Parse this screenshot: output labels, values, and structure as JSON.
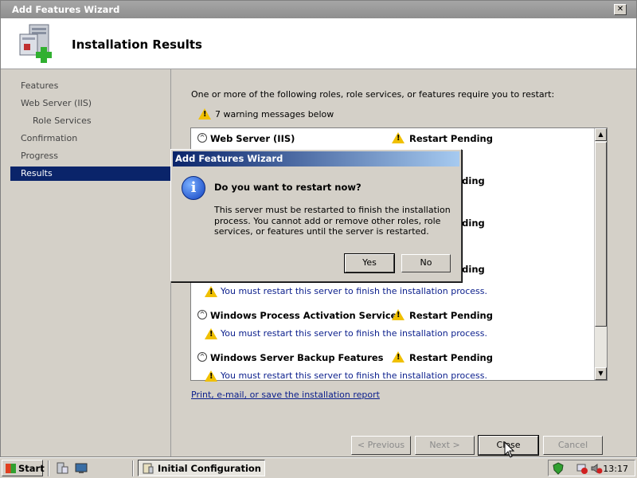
{
  "window": {
    "title": "Add Features Wizard",
    "close_glyph": "✕"
  },
  "header": {
    "page_title": "Installation Results"
  },
  "sidebar": {
    "items": [
      {
        "label": "Features"
      },
      {
        "label": "Web Server (IIS)"
      },
      {
        "label": "Role Services"
      },
      {
        "label": "Confirmation"
      },
      {
        "label": "Progress"
      },
      {
        "label": "Results"
      }
    ]
  },
  "main": {
    "restart_message": "One or more of the following roles, role services, or features require you to restart:",
    "warning_summary": "7 warning messages below",
    "groups": [
      {
        "name": "Web Server (IIS)",
        "status": "Restart Pending",
        "message": ""
      },
      {
        "name": "",
        "status": "",
        "message": "You must restart this server to finish the installation process."
      },
      {
        "name": "Windows Process Activation Service",
        "status": "Restart Pending",
        "message": "You must restart this server to finish the installation process."
      },
      {
        "name": "Windows Server Backup Features",
        "status": "Restart Pending",
        "message": "You must restart this server to finish the installation process."
      }
    ],
    "partial_status": "nding",
    "report_link": "Print, e-mail, or save the installation report",
    "buttons": {
      "previous": "< Previous",
      "next": "Next >",
      "close": "Close",
      "cancel": "Cancel"
    }
  },
  "dialog": {
    "title": "Add Features Wizard",
    "question": "Do you want to restart now?",
    "body": "This server must be restarted to finish the installation process. You cannot add or remove other roles, role services, or features until the server is restarted.",
    "yes": "Yes",
    "no": "No",
    "info_glyph": "i"
  },
  "taskbar": {
    "start": "Start",
    "task": "Initial Configuration T...",
    "clock": "13:17"
  },
  "colors": {
    "selection": "#0a246a",
    "warning": "#f0c000",
    "link": "#0a1e8c"
  }
}
